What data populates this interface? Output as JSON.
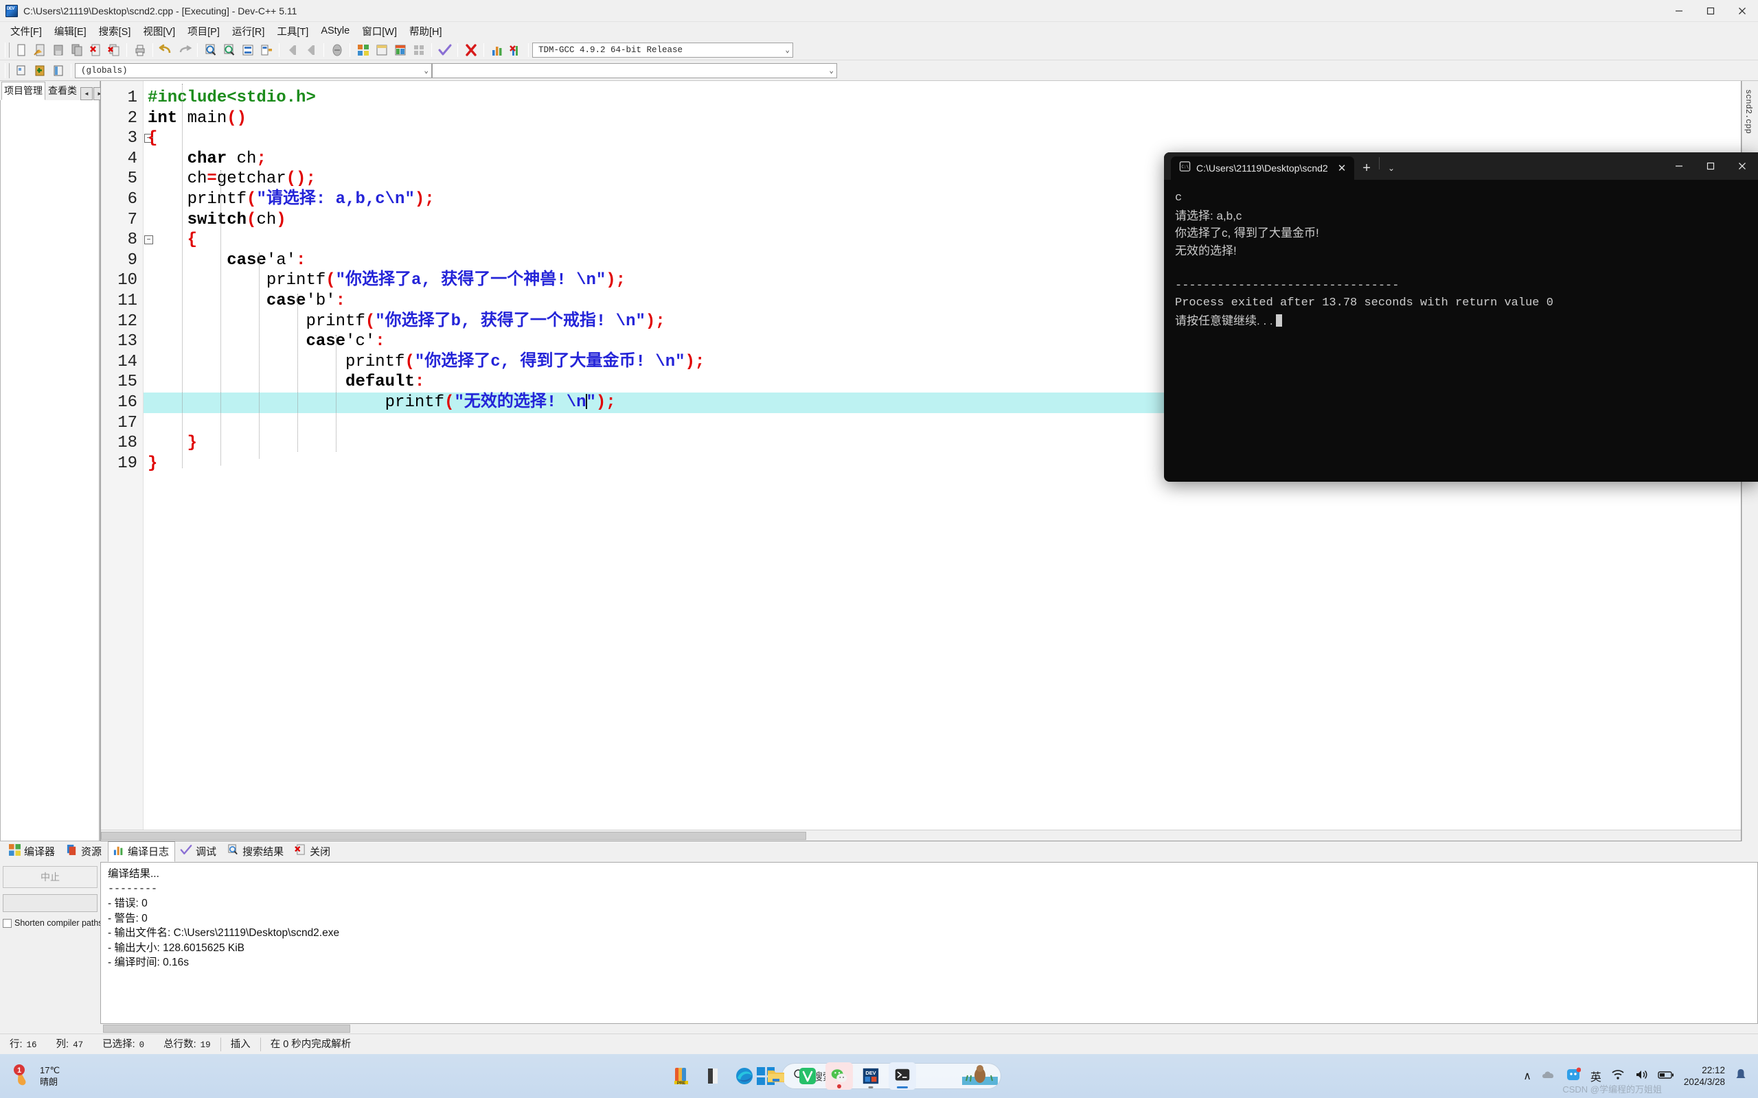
{
  "window": {
    "title": "C:\\Users\\21119\\Desktop\\scnd2.cpp - [Executing] - Dev-C++ 5.11",
    "minimize": "–",
    "maximize": "☐",
    "close": "✕"
  },
  "menu": [
    "文件[F]",
    "编辑[E]",
    "搜索[S]",
    "视图[V]",
    "项目[P]",
    "运行[R]",
    "工具[T]",
    "AStyle",
    "窗口[W]",
    "帮助[H]"
  ],
  "toolbar": {
    "compiler_value": "TDM-GCC 4.9.2 64-bit Release",
    "globals_value": "(globals)",
    "empty_value": "",
    "caret": "⌄",
    "icons": [
      "new-file-icon",
      "open-file-icon",
      "save-icon",
      "save-all-icon",
      "close-file-icon",
      "close-all-icon",
      "print-icon",
      "undo-icon",
      "redo-icon",
      "find-icon",
      "replace-icon",
      "goto-line-icon",
      "goto-function-icon",
      "back-icon",
      "forward-icon",
      "toggle-icon",
      "compile-icon",
      "run-icon",
      "compile-run-icon",
      "rebuild-icon",
      "check-syntax-icon",
      "stop-icon",
      "profile-icon",
      "delete-profile-icon",
      "new-project-icon",
      "add-to-project-icon",
      "remove-from-project-icon"
    ]
  },
  "left_dock": {
    "tabs": [
      "项目管理",
      "查看类"
    ],
    "nav_prev": "◄",
    "nav_next": "►"
  },
  "editor": {
    "right_vertical_tab": "scnd2.cpp",
    "right_close": "×",
    "highlight_line": 16,
    "lines": [
      {
        "n": 1,
        "fold": false,
        "tokens": [
          {
            "t": "#include<stdio.h>",
            "c": "pp"
          }
        ]
      },
      {
        "n": 2,
        "fold": false,
        "tokens": [
          {
            "t": "int",
            "c": "k"
          },
          {
            "t": " main",
            "c": "pl"
          },
          {
            "t": "()",
            "c": "pn"
          }
        ]
      },
      {
        "n": 3,
        "fold": true,
        "tokens": [
          {
            "t": "{",
            "c": "pn"
          }
        ]
      },
      {
        "n": 4,
        "fold": false,
        "tokens": [
          {
            "t": "    ",
            "c": "pl"
          },
          {
            "t": "char",
            "c": "k"
          },
          {
            "t": " ch",
            "c": "pl"
          },
          {
            "t": ";",
            "c": "pn"
          }
        ]
      },
      {
        "n": 5,
        "fold": false,
        "tokens": [
          {
            "t": "    ch",
            "c": "pl"
          },
          {
            "t": "=",
            "c": "pn"
          },
          {
            "t": "getchar",
            "c": "pl"
          },
          {
            "t": "();",
            "c": "pn"
          }
        ]
      },
      {
        "n": 6,
        "fold": false,
        "tokens": [
          {
            "t": "    printf",
            "c": "pl"
          },
          {
            "t": "(",
            "c": "pn"
          },
          {
            "t": "\"请选择: a,b,c\\n\"",
            "c": "st"
          },
          {
            "t": ");",
            "c": "pn"
          }
        ]
      },
      {
        "n": 7,
        "fold": false,
        "tokens": [
          {
            "t": "    ",
            "c": "pl"
          },
          {
            "t": "switch",
            "c": "k"
          },
          {
            "t": "(",
            "c": "pn"
          },
          {
            "t": "ch",
            "c": "pl"
          },
          {
            "t": ")",
            "c": "pn"
          }
        ]
      },
      {
        "n": 8,
        "fold": true,
        "tokens": [
          {
            "t": "    ",
            "c": "pl"
          },
          {
            "t": "{",
            "c": "pn"
          }
        ]
      },
      {
        "n": 9,
        "fold": false,
        "tokens": [
          {
            "t": "        ",
            "c": "pl"
          },
          {
            "t": "case",
            "c": "k"
          },
          {
            "t": "'a'",
            "c": "pl"
          },
          {
            "t": ":",
            "c": "pn"
          }
        ]
      },
      {
        "n": 10,
        "fold": false,
        "tokens": [
          {
            "t": "            printf",
            "c": "pl"
          },
          {
            "t": "(",
            "c": "pn"
          },
          {
            "t": "\"你选择了a, 获得了一个神兽! \\n\"",
            "c": "st"
          },
          {
            "t": ");",
            "c": "pn"
          }
        ]
      },
      {
        "n": 11,
        "fold": false,
        "tokens": [
          {
            "t": "            ",
            "c": "pl"
          },
          {
            "t": "case",
            "c": "k"
          },
          {
            "t": "'b'",
            "c": "pl"
          },
          {
            "t": ":",
            "c": "pn"
          }
        ]
      },
      {
        "n": 12,
        "fold": false,
        "tokens": [
          {
            "t": "                printf",
            "c": "pl"
          },
          {
            "t": "(",
            "c": "pn"
          },
          {
            "t": "\"你选择了b, 获得了一个戒指! \\n\"",
            "c": "st"
          },
          {
            "t": ");",
            "c": "pn"
          }
        ]
      },
      {
        "n": 13,
        "fold": false,
        "tokens": [
          {
            "t": "                ",
            "c": "pl"
          },
          {
            "t": "case",
            "c": "k"
          },
          {
            "t": "'c'",
            "c": "pl"
          },
          {
            "t": ":",
            "c": "pn"
          }
        ]
      },
      {
        "n": 14,
        "fold": false,
        "tokens": [
          {
            "t": "                    printf",
            "c": "pl"
          },
          {
            "t": "(",
            "c": "pn"
          },
          {
            "t": "\"你选择了c, 得到了大量金币! \\n\"",
            "c": "st"
          },
          {
            "t": ");",
            "c": "pn"
          }
        ]
      },
      {
        "n": 15,
        "fold": false,
        "tokens": [
          {
            "t": "                    ",
            "c": "pl"
          },
          {
            "t": "default",
            "c": "k"
          },
          {
            "t": ":",
            "c": "pn"
          }
        ]
      },
      {
        "n": 16,
        "fold": false,
        "tokens": [
          {
            "t": "                        printf",
            "c": "pl"
          },
          {
            "t": "(",
            "c": "pn"
          },
          {
            "t": "\"无效的选择! \\n",
            "c": "st"
          },
          {
            "t": "|CURSOR|",
            "c": "cur"
          },
          {
            "t": "\"",
            "c": "st"
          },
          {
            "t": ");",
            "c": "pn"
          }
        ]
      },
      {
        "n": 17,
        "fold": false,
        "tokens": []
      },
      {
        "n": 18,
        "fold": false,
        "tokens": [
          {
            "t": "    ",
            "c": "pl"
          },
          {
            "t": "}",
            "c": "pn"
          }
        ]
      },
      {
        "n": 19,
        "fold": false,
        "tokens": [
          {
            "t": "}",
            "c": "pn"
          }
        ]
      }
    ]
  },
  "bottom_panel": {
    "tabs": [
      {
        "label": "编译器",
        "icon": "compiler-icon",
        "active": false
      },
      {
        "label": "资源",
        "icon": "resource-icon",
        "active": false
      },
      {
        "label": "编译日志",
        "icon": "log-icon",
        "active": true
      },
      {
        "label": "调试",
        "icon": "debug-check-icon",
        "active": false
      },
      {
        "label": "搜索结果",
        "icon": "search-results-icon",
        "active": false
      },
      {
        "label": "关闭",
        "icon": "close-tab-icon",
        "active": false
      }
    ],
    "abort_button": "中止",
    "shorten_label": "Shorten compiler paths",
    "log": [
      "编译结果...",
      "--------",
      "- 错误: 0",
      "- 警告: 0",
      "- 输出文件名: C:\\Users\\21119\\Desktop\\scnd2.exe",
      "- 输出大小: 128.6015625 KiB",
      "- 编译时间: 0.16s"
    ]
  },
  "statusbar": {
    "items": [
      {
        "label": "行:",
        "value": "16"
      },
      {
        "label": "列:",
        "value": "47"
      },
      {
        "label": "已选择:",
        "value": "0"
      },
      {
        "label": "总行数:",
        "value": "19"
      }
    ],
    "insert_mode": "插入",
    "parse_status": "在 0 秒内完成解析"
  },
  "console": {
    "tab_title": "C:\\Users\\21119\\Desktop\\scnd2",
    "tab_close": "✕",
    "new_tab": "+",
    "dropdown": "⌄",
    "minimize": "–",
    "maximize": "☐",
    "close": "✕",
    "lines": [
      "c",
      "请选择: a,b,c",
      "你选择了c, 得到了大量金币!",
      "无效的选择!",
      "",
      "--------------------------------",
      "Process exited after 13.78 seconds with return value 0",
      "请按任意键继续. . ."
    ]
  },
  "taskbar": {
    "weather_temp": "17℃",
    "weather_desc": "晴朗",
    "weather_badge": "1",
    "search_placeholder": "搜索",
    "apps": [
      "note-app-icon",
      "edge-icon",
      "file-explorer-icon",
      "vivaldi-icon",
      "wechat-icon",
      "dev-cpp-icon",
      "terminal-icon"
    ],
    "tray": {
      "chevron": "∧",
      "onedrive": "onedrive-icon",
      "user-chat": "chat-icon",
      "ime": "英",
      "wifi": "wifi-icon",
      "volume": "volume-icon",
      "battery": "battery-icon"
    },
    "clock_time": "22:12",
    "clock_date": "2024/3/28"
  },
  "watermark": "CSDN @学编程的万姐姐"
}
